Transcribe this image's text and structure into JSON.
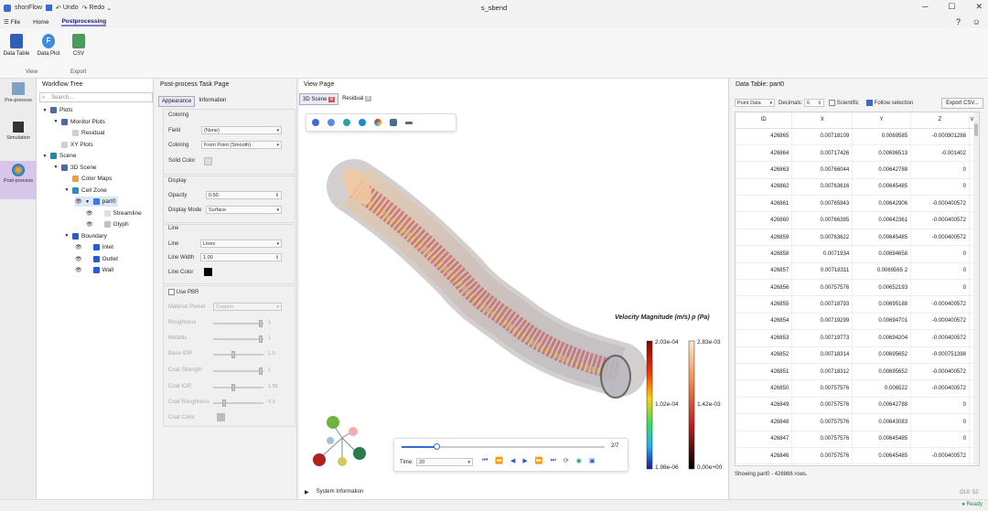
{
  "titlebar": {
    "app": "shonFlow",
    "undo": "Undo",
    "redo": "Redo",
    "doc_title": "s_sbend"
  },
  "menu": {
    "file": "File",
    "home": "Home",
    "postprocessing": "Postprocessing"
  },
  "ribbon": {
    "data_table": "Data Table",
    "data_plot": "Data Plot",
    "csv": "CSV",
    "group_view": "View",
    "group_export": "Export"
  },
  "sidebar": {
    "preprocess": "Pre-process",
    "simulation": "Simulation",
    "postprocess": "Post-process"
  },
  "tree": {
    "title": "Workflow Tree",
    "search_placeholder": "Search...",
    "items": [
      "Plots",
      "Monitor Plots",
      "Residual",
      "XY Plots",
      "Scene",
      "3D Scene",
      "Color Maps",
      "Cell Zone",
      "part0",
      "Streamline",
      "Glyph",
      "Boundary",
      "Inlet",
      "Outlet",
      "Wall"
    ]
  },
  "task": {
    "title": "Post-process Task Page",
    "tab_appearance": "Appearance",
    "tab_information": "Information",
    "coloring": "Coloring",
    "field_label": "Field",
    "field_value": "(None)",
    "coloring_label": "Coloring",
    "coloring_value": "From Point (Smooth)",
    "solid_color": "Solid Color",
    "display": "Display",
    "opacity_label": "Opacity",
    "opacity_value": "0.50",
    "display_mode_label": "Display Mode",
    "display_mode_value": "Surface",
    "line": "Line",
    "line_label": "Line",
    "line_value": "Lines",
    "line_width_label": "Line Width",
    "line_width_value": "1.00",
    "line_color": "Line Color",
    "use_pbr": "Use PBR",
    "material_preset": "Material Preset",
    "material_value": "Custom",
    "roughness": "Roughness",
    "roughness_v": "1",
    "metallic": "Metallic",
    "metallic_v": "1",
    "base_ior": "Base IOR",
    "base_ior_v": "1.5",
    "coat_strength": "Coat Strength",
    "coat_strength_v": "1",
    "coat_ior": "Coat IOR",
    "coat_ior_v": "1.55",
    "coat_roughness": "Coat Roughness",
    "coat_roughness_v": "0.2",
    "coat_color": "Coat Color"
  },
  "view": {
    "title": "View Page",
    "tab_3d": "3D Scene",
    "tab_residual": "Residual",
    "legend_title": "Velocity Magnitude (m/s)",
    "legend_title2": "p (Pa)",
    "legend1": {
      "max": "2.03e-04",
      "mid": "1.02e-04",
      "min": "1.98e-06"
    },
    "legend2": {
      "max": "2.83e-03",
      "mid": "1.42e-03",
      "min": "0.00e+00"
    },
    "frame": "2/7",
    "frame_progress": 0.17,
    "time_label": "Time:",
    "time_value": "20",
    "system_information": "System Information"
  },
  "datatable": {
    "title": "Data Table: part0",
    "source": "Point Data",
    "decimals_label": "Decimals:",
    "decimals_value": "6",
    "scientific": "Scientific",
    "follow_selection": "Follow selection",
    "export": "Export CSV...",
    "columns": [
      "ID",
      "X",
      "Y",
      "Z",
      "V"
    ],
    "rows": [
      [
        "426865",
        "0.00718109",
        "0.0069585",
        "-0.000901288"
      ],
      [
        "426864",
        "0.00717426",
        "0.00696513",
        "-0.001402"
      ],
      [
        "426863",
        "0.00766044",
        "0.00642788",
        "0"
      ],
      [
        "426862",
        "0.00763616",
        "0.00645485",
        "0"
      ],
      [
        "426861",
        "0.00765943",
        "0.00642906",
        "-0.000400572"
      ],
      [
        "426860",
        "0.00766385",
        "0.00642361",
        "-0.000400572"
      ],
      [
        "426859",
        "0.00763622",
        "0.00645485",
        "-0.000400572"
      ],
      [
        "426858",
        "0.0071934",
        "0.00694658",
        "0"
      ],
      [
        "426857",
        "0.00718311",
        "0.0069565 2",
        "0"
      ],
      [
        "426856",
        "0.00757576",
        "0.00652193",
        "0"
      ],
      [
        "426855",
        "0.00718793",
        "0.00695188",
        "-0.000400572"
      ],
      [
        "426854",
        "0.00719299",
        "0.00694701",
        "-0.000400572"
      ],
      [
        "426853",
        "0.00719773",
        "0.00694204",
        "-0.000400572"
      ],
      [
        "426852",
        "0.00718314",
        "0.00695652",
        "-0.000751398"
      ],
      [
        "426851",
        "0.00718312",
        "0.00695652",
        "-0.000400572"
      ],
      [
        "426850",
        "0.00757576",
        "0.006522",
        "-0.000400572"
      ],
      [
        "426849",
        "0.00757576",
        "0.00642788",
        "0"
      ],
      [
        "426848",
        "0.00757576",
        "0.00643083",
        "0"
      ],
      [
        "426847",
        "0.00757576",
        "0.00645485",
        "0"
      ],
      [
        "426846",
        "0.00757576",
        "0.00645485",
        "-0.000400572"
      ]
    ],
    "showing": "Showing part0 - 426866 rows.",
    "gui": "GUI: 52"
  },
  "status": {
    "ready": "Ready"
  },
  "colors": {
    "accent": "#7a3fb8",
    "pipe": "#c9b8a6"
  }
}
